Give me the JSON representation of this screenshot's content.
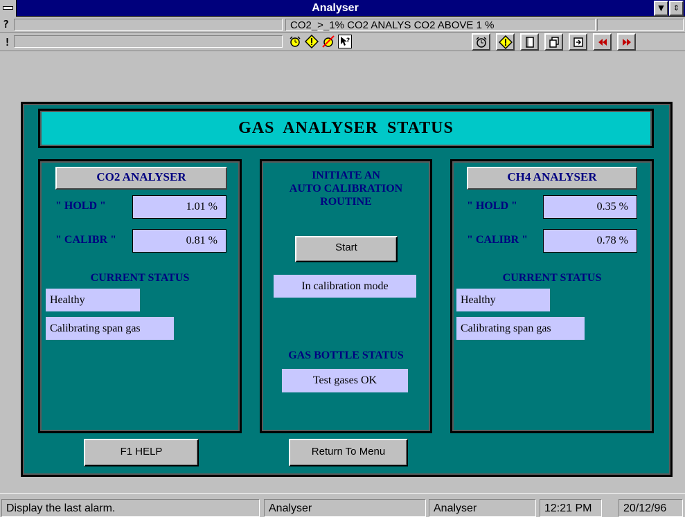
{
  "window": {
    "title": "Analyser",
    "dropdown_glyph": "▼",
    "scroll_glyph": "⇕"
  },
  "alarm_bar": {
    "question_glyph": "?",
    "exclaim_glyph": "!",
    "alarm_text": "CO2_>_1%   CO2 ANALYS CO2 ABOVE 1 %",
    "small_icons": [
      "alarm-clock-icon",
      "warning-diamond-icon",
      "alarm-off-icon",
      "help-pointer-icon"
    ],
    "buttons": [
      "alarm-clock-icon",
      "warning-diamond-icon",
      "document-icon",
      "copy-windows-icon",
      "export-icon",
      "rewind-icon",
      "fast-forward-icon"
    ]
  },
  "header": {
    "title": "GAS  ANALYSER  STATUS"
  },
  "co2": {
    "title": "CO2  ANALYSER",
    "hold_label": "\" HOLD \"",
    "hold_value": "1.01 %",
    "calibr_label": "\" CALIBR \"",
    "calibr_value": "0.81 %",
    "status_heading": "CURRENT STATUS",
    "status1": "Healthy",
    "status2": "Calibrating span gas"
  },
  "middle": {
    "heading_line1": "INITIATE  AN",
    "heading_line2": "AUTO  CALIBRATION",
    "heading_line3": "ROUTINE",
    "start_label": "Start",
    "mode_text": "In calibration mode",
    "bottle_heading": "GAS BOTTLE STATUS",
    "bottle_status": "Test gases OK"
  },
  "ch4": {
    "title": "CH4  ANALYSER",
    "hold_label": "\" HOLD \"",
    "hold_value": "0.35 %",
    "calibr_label": "\" CALIBR \"",
    "calibr_value": "0.78 %",
    "status_heading": "CURRENT STATUS",
    "status1": "Healthy",
    "status2": "Calibrating span gas"
  },
  "footer_buttons": {
    "help": "F1 HELP",
    "menu": "Return To Menu"
  },
  "statusbar": {
    "message": "Display the last alarm.",
    "cell2": "Analyser",
    "cell3": "Analyser",
    "time": "12:21 PM",
    "date": "20/12/96"
  },
  "colors": {
    "titlebar": "#00007c",
    "panel_teal": "#007878",
    "header_cyan": "#00c8c8",
    "value_box": "#c8c8ff",
    "label_navy": "#000080"
  }
}
